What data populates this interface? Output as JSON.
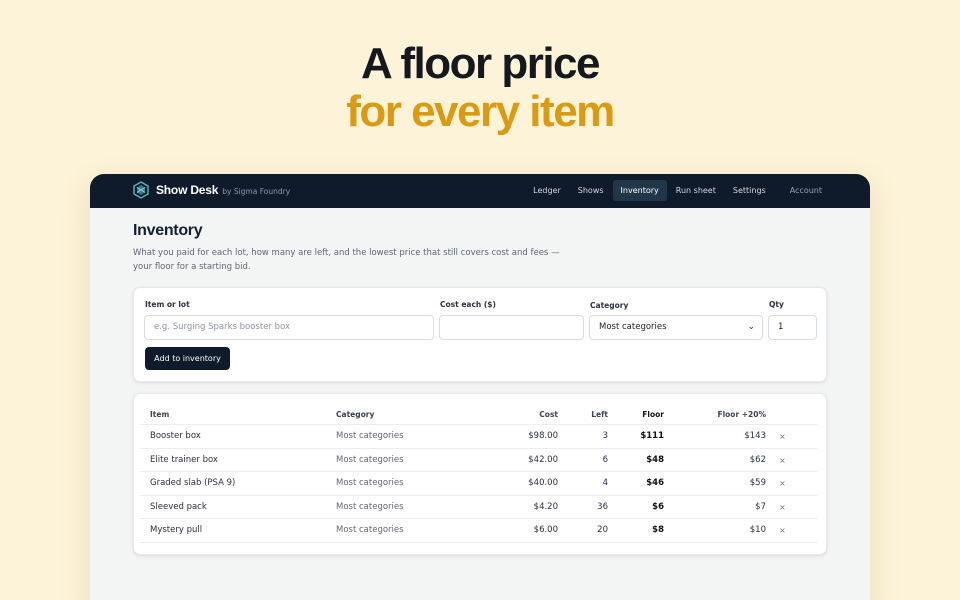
{
  "hero": {
    "line1": "A floor price",
    "line2": "for every item"
  },
  "app": {
    "name": "Show Desk",
    "byline": "by Sigma Foundry",
    "nav": [
      "Ledger",
      "Shows",
      "Inventory",
      "Run sheet",
      "Settings",
      "Account"
    ],
    "active_nav": "Inventory"
  },
  "page": {
    "title": "Inventory",
    "description": "What you paid for each lot, how many are left, and the lowest price that still covers cost and fees — your floor for a starting bid."
  },
  "form": {
    "item_label": "Item or lot",
    "item_placeholder": "e.g. Surging Sparks booster box",
    "cost_label": "Cost each ($)",
    "cost_value": "",
    "category_label": "Category",
    "category_value": "Most categories",
    "qty_label": "Qty",
    "qty_value": "1",
    "add_button": "Add to inventory"
  },
  "table": {
    "headers": {
      "item": "Item",
      "category": "Category",
      "cost": "Cost",
      "left": "Left",
      "floor": "Floor",
      "floor20": "Floor +20%"
    },
    "remove_glyph": "×",
    "rows": [
      {
        "item": "Booster box",
        "category": "Most categories",
        "cost": "$98.00",
        "left": "3",
        "floor": "$111",
        "floor20": "$143"
      },
      {
        "item": "Elite trainer box",
        "category": "Most categories",
        "cost": "$42.00",
        "left": "6",
        "floor": "$48",
        "floor20": "$62"
      },
      {
        "item": "Graded slab (PSA 9)",
        "category": "Most categories",
        "cost": "$40.00",
        "left": "4",
        "floor": "$46",
        "floor20": "$59"
      },
      {
        "item": "Sleeved pack",
        "category": "Most categories",
        "cost": "$4.20",
        "left": "36",
        "floor": "$6",
        "floor20": "$7"
      },
      {
        "item": "Mystery pull",
        "category": "Most categories",
        "cost": "$6.00",
        "left": "20",
        "floor": "$8",
        "floor20": "$10"
      }
    ]
  },
  "colors": {
    "background": "#fdf3d8",
    "accent": "#dc9a0e",
    "nav_bg": "#0f1a2a"
  }
}
